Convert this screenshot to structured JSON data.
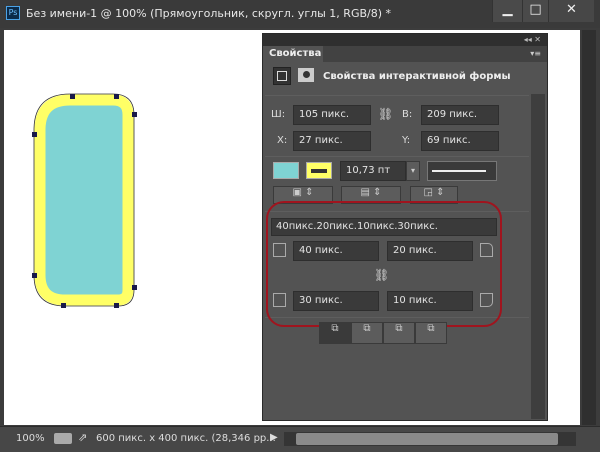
{
  "window": {
    "title": "Без имени-1 @ 100% (Прямоугольник, скругл. углы 1, RGB/8) *",
    "app_icon": "Ps",
    "minimize": "▁",
    "maximize": "□",
    "close": "✕"
  },
  "panel": {
    "tab": "Свойства",
    "header_icons": "◂◂ ✕",
    "menu_icon": "▾≡",
    "heading": "Свойства интерактивной формы",
    "width_label": "Ш:",
    "width": "105 пикс.",
    "height_label": "В:",
    "height": "209 пикс.",
    "x_label": "X:",
    "x": "27 пикс.",
    "y_label": "Y:",
    "y": "69 пикс.",
    "fill_color": "#7fd3d3",
    "stroke_color": "#ffff66",
    "stroke_width": "10,73 пт",
    "corners_summary": "40пикс.20пикс.10пикс.30пикс.",
    "corner_tl": "40 пикс.",
    "corner_tr": "20 пикс.",
    "corner_bl": "30 пикс.",
    "corner_br": "10 пикс."
  },
  "status": {
    "zoom": "100%",
    "doc_info": "600 пикс. x 400 пикс. (28,346 pp..."
  }
}
